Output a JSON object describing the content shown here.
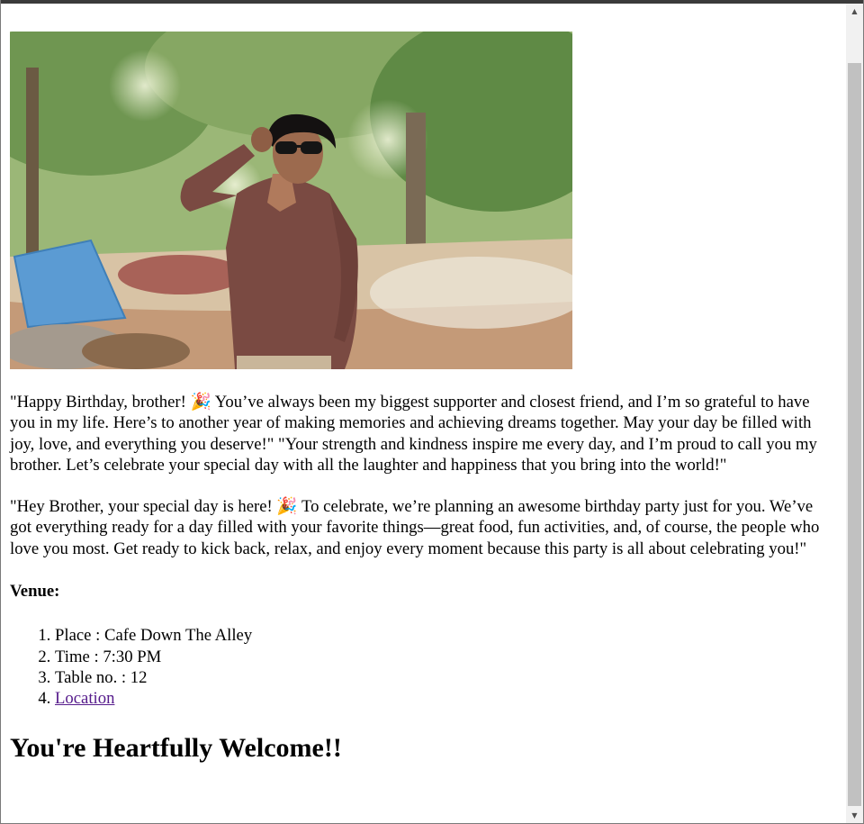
{
  "photo": {
    "alt": "Young man in a brown shirt wearing sunglasses, standing outdoors"
  },
  "paragraphs": {
    "wish": "\"Happy Birthday, brother! 🎉 You’ve always been my biggest supporter and closest friend, and I’m so grateful to have you in my life. Here’s to another year of making memories and achieving dreams together. May your day be filled with joy, love, and everything you deserve!\" \"Your strength and kindness inspire me every day, and I’m proud to call you my brother. Let’s celebrate your special day with all the laughter and happiness that you bring into the world!\"",
    "invite": "\"Hey Brother, your special day is here! 🎉 To celebrate, we’re planning an awesome birthday party just for you. We’ve got everything ready for a day filled with your favorite things—great food, fun activities, and, of course, the people who love you most. Get ready to kick back, relax, and enjoy every moment because this party is all about celebrating you!\""
  },
  "venue": {
    "heading": "Venue:",
    "items": [
      "Place : Cafe Down The Alley",
      "Time : 7:30 PM",
      "Table no. : 12"
    ],
    "location_link": "Location"
  },
  "closing": "You're Heartfully Welcome!!",
  "icons": {
    "scroll_up": "scroll-up-arrow-icon",
    "scroll_down": "scroll-down-arrow-icon"
  },
  "colors": {
    "link_visited": "#551a8b",
    "scrollbar_thumb": "#c1c1c1",
    "scrollbar_track": "#f1f1f1"
  }
}
